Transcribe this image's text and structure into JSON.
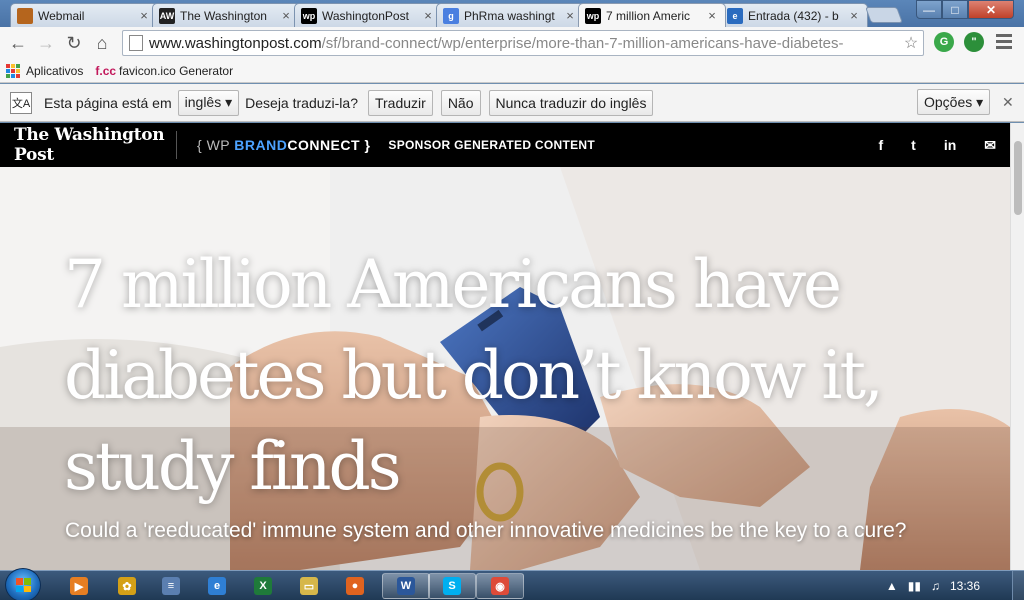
{
  "tabs": [
    {
      "title": "Webmail",
      "icon": "webmail-favicon",
      "color": "#b5651d",
      "glyph": "",
      "active": false
    },
    {
      "title": "The Washington",
      "icon": "aw-favicon",
      "color": "#222222",
      "glyph": "AW",
      "active": false
    },
    {
      "title": "WashingtonPost",
      "icon": "wp-favicon",
      "color": "#000000",
      "glyph": "wp",
      "active": false
    },
    {
      "title": "PhRma washingt",
      "icon": "google-favicon",
      "color": "#4a7fe0",
      "glyph": "g",
      "active": false
    },
    {
      "title": "7 million Americ",
      "icon": "wp-favicon",
      "color": "#000000",
      "glyph": "wp",
      "active": true
    },
    {
      "title": "Entrada (432) - b",
      "icon": "mail-favicon",
      "color": "#2a6bbf",
      "glyph": "e",
      "active": false
    }
  ],
  "tab_close": "×",
  "window": {
    "min": "—",
    "max": "□",
    "close": "✕"
  },
  "toolbar": {
    "back": "←",
    "forward": "→",
    "reload": "↻",
    "home": "⌂",
    "url_domain": "www.washingtonpost.com",
    "url_path": "/sf/brand-connect/wp/enterprise/more-than-7-million-americans-have-diabetes-",
    "star": "☆"
  },
  "bookmarks": {
    "apps_label": "Aplicativos",
    "favicon_generator_prefix": "f.cc",
    "favicon_generator_label": "favicon.ico Generator"
  },
  "translate": {
    "prompt": "Esta página está em",
    "language": "inglês ▾",
    "question": "Deseja traduzi-la?",
    "translate_btn": "Traduzir",
    "no_btn": "Não",
    "never_btn": "Nunca traduzir do inglês",
    "options_btn": "Opções ▾",
    "close": "✕"
  },
  "wp_header": {
    "logo": "The Washington Post",
    "brand_open": "{ WP ",
    "brand_accent": "BRAND",
    "brand_rest": "CONNECT }",
    "sponsor": "SPONSOR GENERATED CONTENT",
    "social": [
      "f",
      "t",
      "in",
      "✉"
    ]
  },
  "article": {
    "headline": "7 million Americans have diabetes but don’t know it, study finds",
    "dek": "Could a 'reeducated' immune system and other innovative medicines be the key to a cure?"
  },
  "taskbar": {
    "items": [
      {
        "name": "media-player-icon",
        "color": "#e67e22",
        "glyph": "▶",
        "open": false
      },
      {
        "name": "sunflower-app-icon",
        "color": "#d4a017",
        "glyph": "✿",
        "open": false
      },
      {
        "name": "document-app-icon",
        "color": "#5b7fb0",
        "glyph": "≡",
        "open": false
      },
      {
        "name": "internet-explorer-icon",
        "color": "#2f7fd4",
        "glyph": "e",
        "open": false
      },
      {
        "name": "excel-icon",
        "color": "#1f7a3a",
        "glyph": "X",
        "open": false
      },
      {
        "name": "file-explorer-icon",
        "color": "#d6b74a",
        "glyph": "▭",
        "open": false
      },
      {
        "name": "firefox-icon",
        "color": "#e0631f",
        "glyph": "●",
        "open": false
      },
      {
        "name": "word-icon",
        "color": "#2b579a",
        "glyph": "W",
        "open": true
      },
      {
        "name": "skype-icon",
        "color": "#00aff0",
        "glyph": "S",
        "open": true
      },
      {
        "name": "chrome-icon",
        "color": "#dd4b39",
        "glyph": "◉",
        "open": true
      }
    ],
    "clock": "13:36",
    "tray_arrow": "▲",
    "volume": "♫"
  }
}
